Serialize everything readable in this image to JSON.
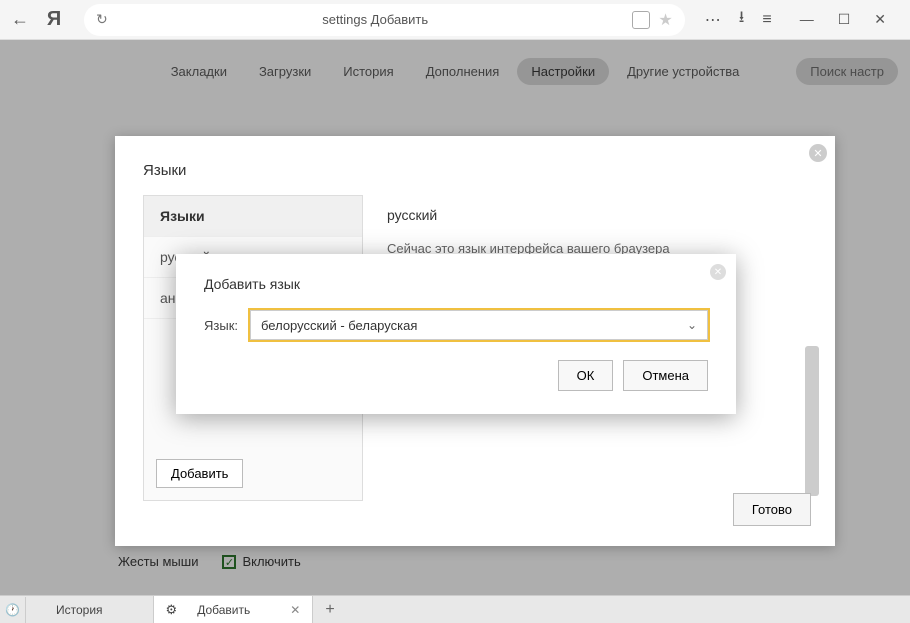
{
  "titlebar": {
    "address": "settings  Добавить"
  },
  "navtabs": [
    "Закладки",
    "Загрузки",
    "История",
    "Дополнения",
    "Настройки",
    "Другие устройства"
  ],
  "navtabs_active_index": 4,
  "search_placeholder": "Поиск настр",
  "lang_panel": {
    "title": "Языки",
    "left_header": "Языки",
    "items": [
      "русский",
      "анг"
    ],
    "add_button": "Добавить",
    "current_lang": "русский",
    "desc": "Сейчас это язык интерфейса вашего браузера",
    "done": "Готово"
  },
  "add_modal": {
    "title": "Добавить язык",
    "label": "Язык:",
    "selected": "белорусский - беларуская",
    "ok": "ОК",
    "cancel": "Отмена"
  },
  "gestures": {
    "label": "Жесты мыши",
    "checkbox_label": "Включить"
  },
  "tabbar": {
    "tab1": "История",
    "tab2": "Добавить"
  }
}
